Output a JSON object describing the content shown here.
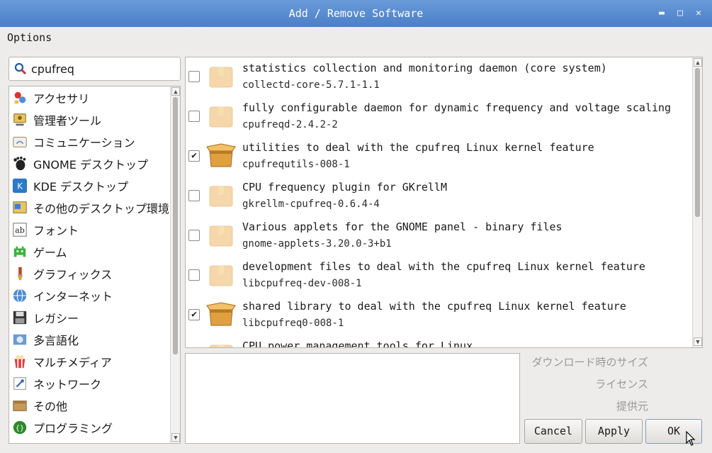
{
  "window": {
    "title": "Add / Remove Software",
    "controls": [
      "✕",
      "□",
      "▫"
    ]
  },
  "menubar": {
    "options": "Options"
  },
  "search": {
    "value": "cpufreq"
  },
  "categories": [
    {
      "label": "アクセサリ",
      "icon": "accessories-icon"
    },
    {
      "label": "管理者ツール",
      "icon": "admin-tools-icon"
    },
    {
      "label": "コミュニケーション",
      "icon": "communication-icon"
    },
    {
      "label": "GNOME デスクトップ",
      "icon": "gnome-icon"
    },
    {
      "label": "KDE デスクトップ",
      "icon": "kde-icon"
    },
    {
      "label": "その他のデスクトップ環境",
      "icon": "other-desktop-icon"
    },
    {
      "label": "フォント",
      "icon": "fonts-icon"
    },
    {
      "label": "ゲーム",
      "icon": "games-icon"
    },
    {
      "label": "グラフィックス",
      "icon": "graphics-icon"
    },
    {
      "label": "インターネット",
      "icon": "internet-icon"
    },
    {
      "label": "レガシー",
      "icon": "legacy-icon"
    },
    {
      "label": "多言語化",
      "icon": "localization-icon"
    },
    {
      "label": "マルチメディア",
      "icon": "multimedia-icon"
    },
    {
      "label": "ネットワーク",
      "icon": "network-icon"
    },
    {
      "label": "その他",
      "icon": "other-icon"
    },
    {
      "label": "プログラミング",
      "icon": "programming-icon"
    }
  ],
  "packages": [
    {
      "desc": "statistics collection and monitoring daemon (core system)",
      "name": "collectd-core-5.7.1-1.1",
      "checked": false
    },
    {
      "desc": "fully configurable daemon for dynamic frequency and voltage scaling",
      "name": "cpufreqd-2.4.2-2",
      "checked": false
    },
    {
      "desc": "utilities to deal with the cpufreq Linux kernel feature",
      "name": "cpufrequtils-008-1",
      "checked": true
    },
    {
      "desc": "CPU frequency plugin for GKrellM",
      "name": "gkrellm-cpufreq-0.6.4-4",
      "checked": false
    },
    {
      "desc": "Various applets for the GNOME panel - binary files",
      "name": "gnome-applets-3.20.0-3+b1",
      "checked": false
    },
    {
      "desc": "development files to deal with the cpufreq Linux kernel feature",
      "name": "libcpufreq-dev-008-1",
      "checked": false
    },
    {
      "desc": "shared library to deal with the cpufreq Linux kernel feature",
      "name": "libcpufreq0-008-1",
      "checked": true
    },
    {
      "desc": "CPU power management tools for Linux",
      "name": "",
      "checked": false
    }
  ],
  "details": {
    "download_size_label": "ダウンロード時のサイズ",
    "license_label": "ライセンス",
    "provider_label": "提供元"
  },
  "buttons": {
    "cancel": "Cancel",
    "apply": "Apply",
    "ok": "OK"
  },
  "colors": {
    "titlebar": "#4a7fc8",
    "background": "#edeceb",
    "package_box": "#f0b866"
  }
}
